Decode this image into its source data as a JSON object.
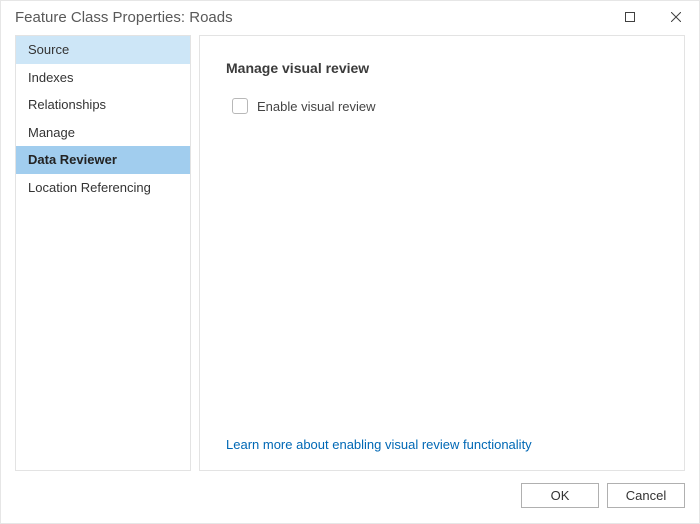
{
  "window": {
    "title": "Feature Class Properties: Roads"
  },
  "sidebar": {
    "items": [
      {
        "label": "Source",
        "state": "hover"
      },
      {
        "label": "Indexes",
        "state": "normal"
      },
      {
        "label": "Relationships",
        "state": "normal"
      },
      {
        "label": "Manage",
        "state": "normal"
      },
      {
        "label": "Data Reviewer",
        "state": "selected"
      },
      {
        "label": "Location Referencing",
        "state": "normal"
      }
    ]
  },
  "panel": {
    "section_title": "Manage visual review",
    "checkbox": {
      "label": "Enable visual review",
      "checked": false
    },
    "learn_more": "Learn more about enabling visual review functionality"
  },
  "buttons": {
    "ok": "OK",
    "cancel": "Cancel"
  }
}
